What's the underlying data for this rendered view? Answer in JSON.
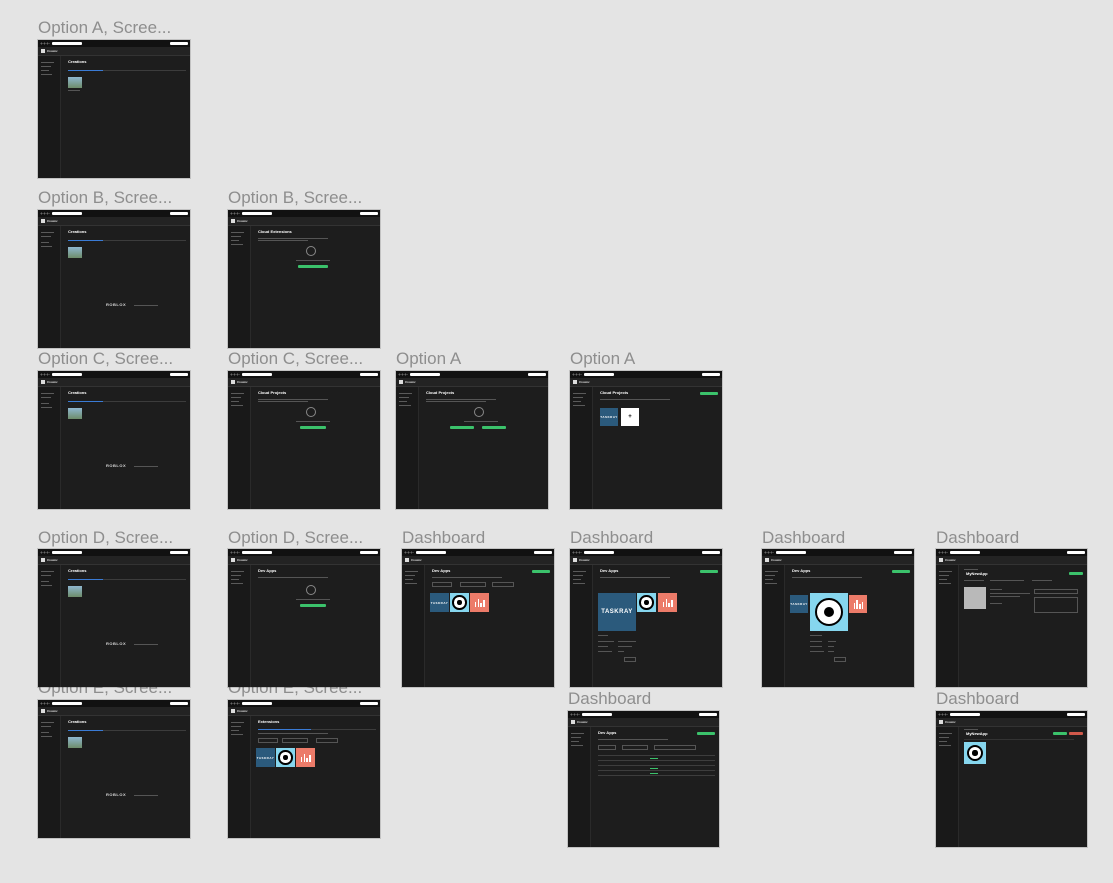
{
  "frame_labels": [
    "Option A, Scree...",
    "Option B, Scree...",
    "Option B, Scree...",
    "Option C, Scree...",
    "Option C, Scree...",
    "Option A",
    "Option A",
    "Option D, Scree...",
    "Option D, Scree...",
    "Dashboard",
    "Dashboard",
    "Dashboard",
    "Dashboard",
    "Option E, Scree...",
    "Option E, Scree...",
    "Dashboard",
    "Dashboard"
  ],
  "screen": {
    "brand": "Creator",
    "creations_title": "Creations",
    "cloud_extensions_title": "Cloud Extensions",
    "cloud_projects_title": "Cloud Projects",
    "dev_apps_title": "Dev Apps",
    "extensions_title": "Extensions",
    "app_name": "MyNewApp",
    "roblox_logo": "ROBLOX",
    "taskray": "TASKRAY",
    "plus": "+"
  },
  "colors": {
    "canvas": "#e4e4e4",
    "label": "#8e8e8e",
    "frame_bg": "#1d1d1d",
    "accent_green": "#3bc26b",
    "taskray_blue": "#2b5a7c",
    "eye_cyan": "#86d6ee",
    "chart_coral": "#ec7b69"
  }
}
